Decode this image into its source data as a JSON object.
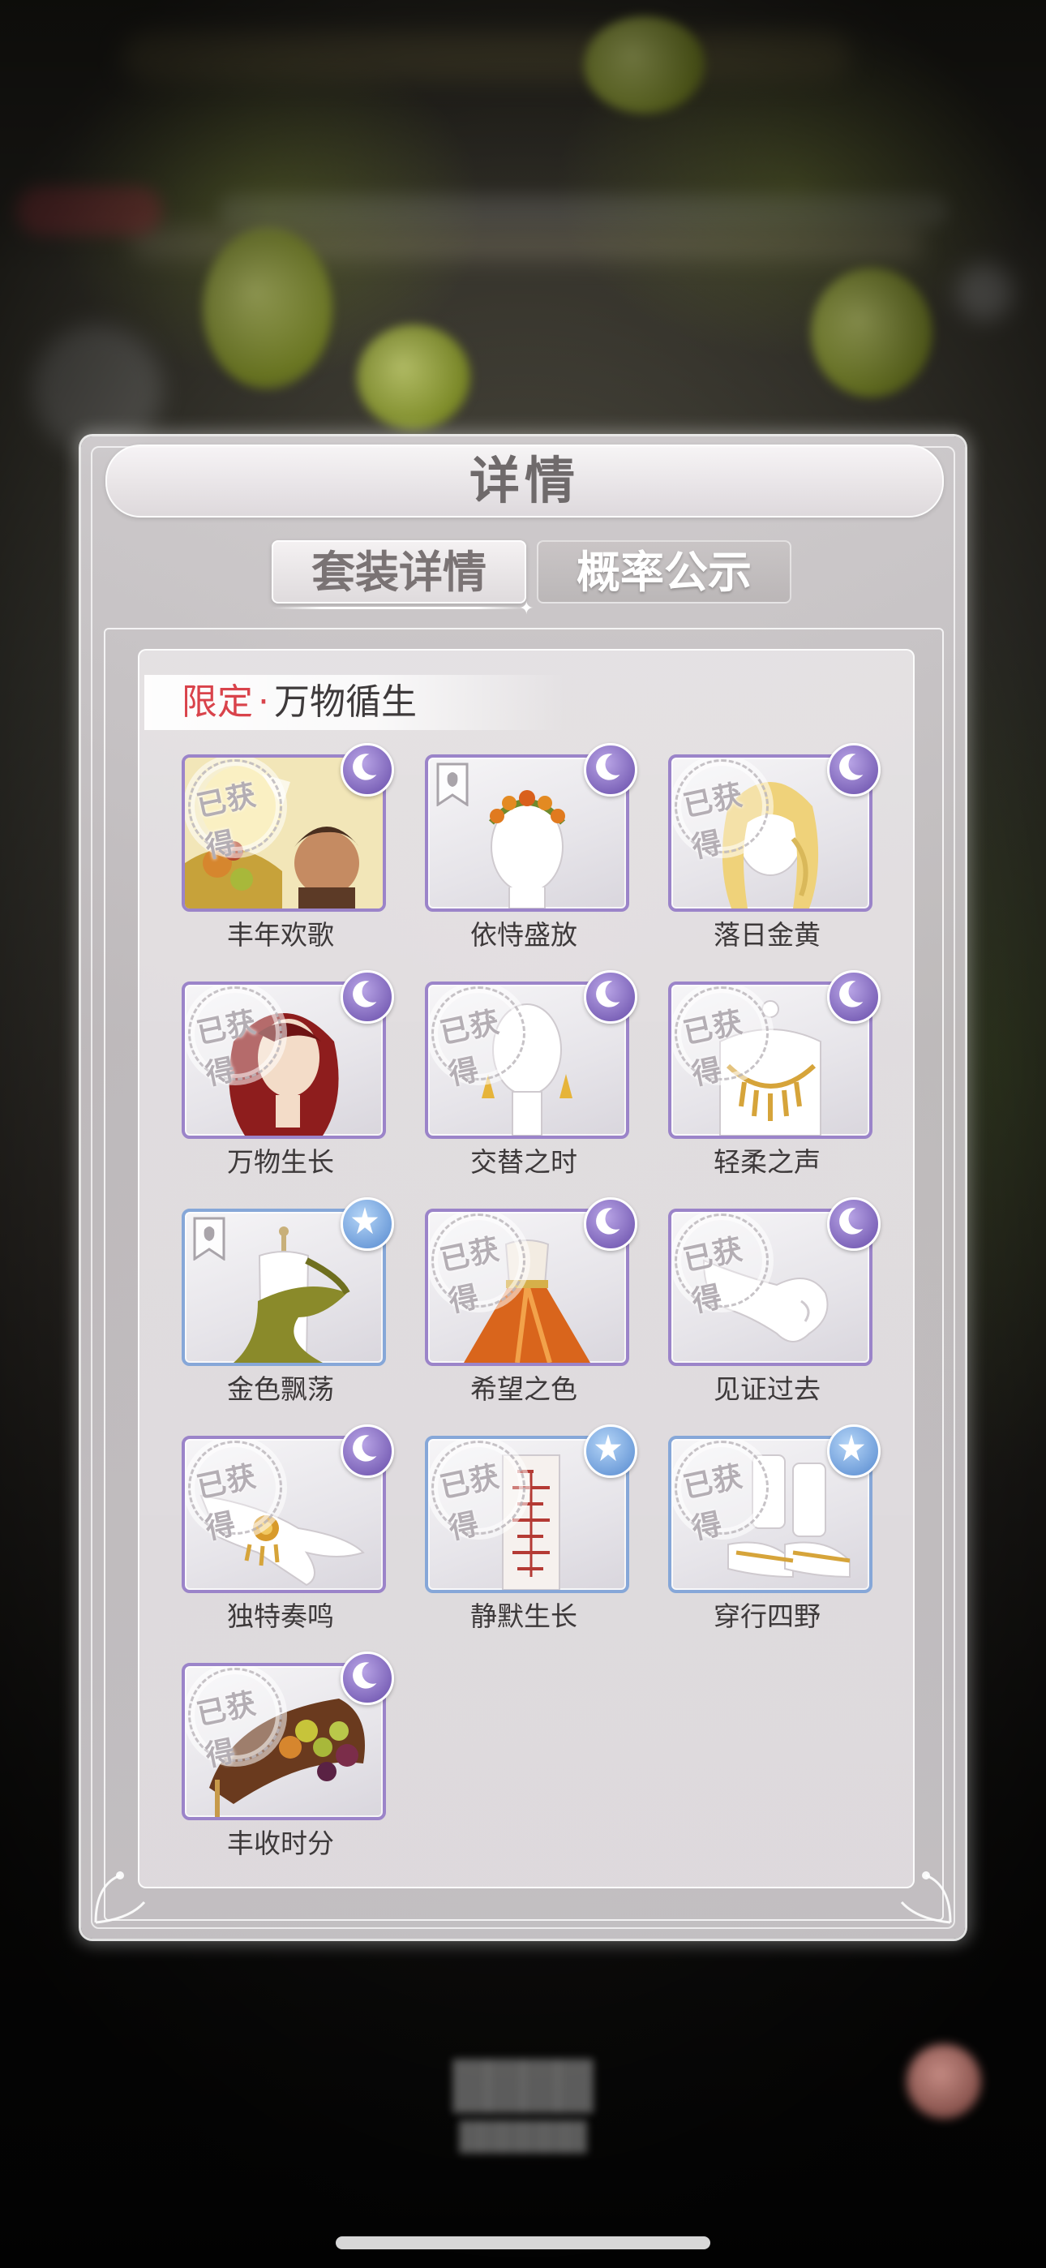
{
  "dialog": {
    "title": "详情",
    "tabs": [
      {
        "label": "套装详情",
        "active": true
      },
      {
        "label": "概率公示",
        "active": false
      }
    ]
  },
  "section": {
    "tag": "限定",
    "separator": "·",
    "title": "万物循生"
  },
  "owned_stamp": "已获得",
  "items": [
    {
      "name": "丰年欢歌",
      "rarity": "moon-icon",
      "frame": "purple",
      "owned": true
    },
    {
      "name": "依恃盛放",
      "rarity": "moon-icon",
      "frame": "purple",
      "owned": false
    },
    {
      "name": "落日金黄",
      "rarity": "moon-icon",
      "frame": "purple",
      "owned": true
    },
    {
      "name": "万物生长",
      "rarity": "moon-icon",
      "frame": "purple",
      "owned": true
    },
    {
      "name": "交替之时",
      "rarity": "moon-icon",
      "frame": "purple",
      "owned": true
    },
    {
      "name": "轻柔之声",
      "rarity": "moon-icon",
      "frame": "purple",
      "owned": true
    },
    {
      "name": "金色飘荡",
      "rarity": "star-icon",
      "frame": "blue",
      "owned": false
    },
    {
      "name": "希望之色",
      "rarity": "moon-icon",
      "frame": "purple",
      "owned": true
    },
    {
      "name": "见证过去",
      "rarity": "moon-icon",
      "frame": "purple",
      "owned": true
    },
    {
      "name": "独特奏鸣",
      "rarity": "moon-icon",
      "frame": "purple",
      "owned": true
    },
    {
      "name": "静默生长",
      "rarity": "star-icon",
      "frame": "blue",
      "owned": true
    },
    {
      "name": "穿行四野",
      "rarity": "star-icon",
      "frame": "blue",
      "owned": true
    },
    {
      "name": "丰收时分",
      "rarity": "moon-icon",
      "frame": "purple",
      "owned": true
    }
  ],
  "colors": {
    "frame_purple": "#9b84c9",
    "frame_blue": "#86a7d8",
    "limited_red": "#d9434b"
  }
}
